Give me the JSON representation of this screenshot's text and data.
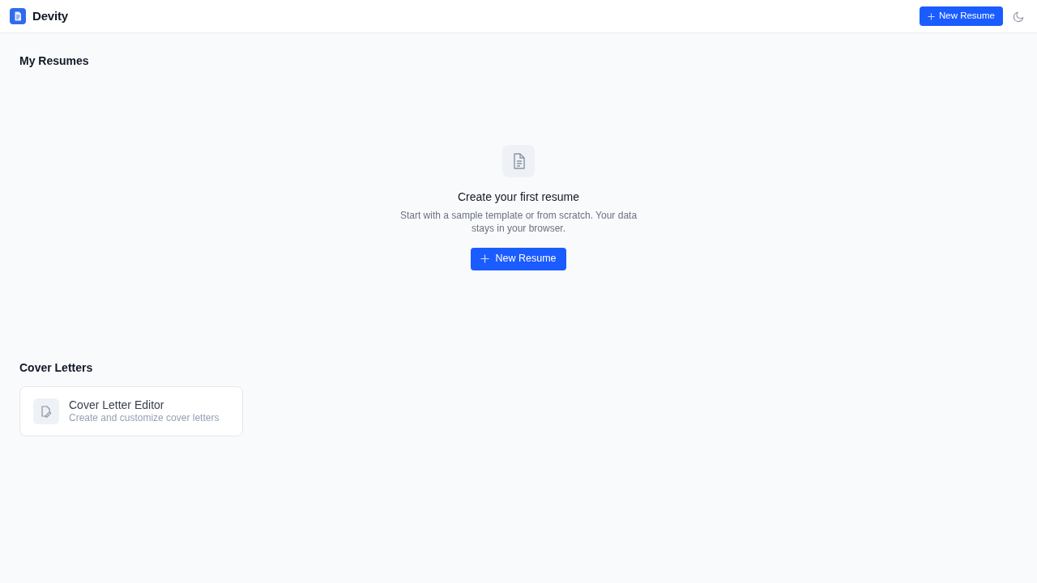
{
  "header": {
    "brand": "Devity",
    "new_button": {
      "label": "New Resume"
    }
  },
  "resumes": {
    "title": "My Resumes",
    "empty_state": {
      "title": "Create your first resume",
      "description": "Start with a sample template or from scratch. Your data stays in your browser.",
      "button": {
        "label": "New Resume"
      }
    }
  },
  "cover_letters": {
    "title": "Cover Letters",
    "cards": [
      {
        "title": "Cover Letter Editor",
        "subtitle": "Create and customize cover letters"
      }
    ]
  }
}
